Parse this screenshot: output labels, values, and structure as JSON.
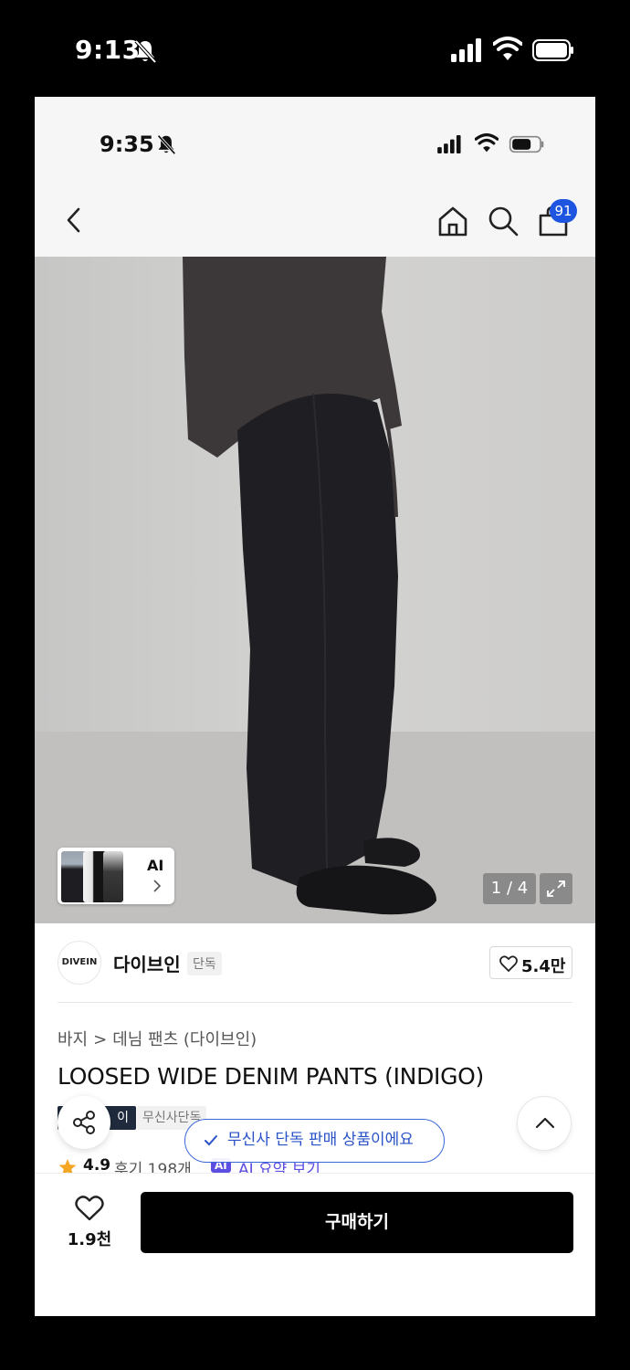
{
  "outer_status": {
    "time": "9:13"
  },
  "inner_status": {
    "time": "9:35"
  },
  "nav": {
    "icons": [
      "back-arrow-icon",
      "home-icon",
      "search-icon",
      "shopping-bag-icon"
    ],
    "cart_count": "91"
  },
  "gallery": {
    "thumb_label": "AI",
    "page_indicator": "1 / 4"
  },
  "brand": {
    "logo_text": "DIVEIN",
    "name": "다이브인",
    "tag": "단독",
    "likes": "5.4만"
  },
  "breadcrumb": {
    "category": "바지",
    "subcategory": "데님 팬츠 (다이브인)"
  },
  "product": {
    "title": "LOOSED WIDE DENIM PANTS (INDIGO)",
    "tag_dark": "이",
    "tag_light": "무신사단독"
  },
  "toast": {
    "message": "무신사 단독 판매 상품이에요"
  },
  "rating": {
    "score": "4.9",
    "reviews": "후기 198개",
    "ai_chip": "AI",
    "ai_summary": "AI 요약 보기"
  },
  "bottom_bar": {
    "wish_count": "1.9천",
    "buy_label": "구매하기"
  },
  "colors": {
    "accent_blue": "#1e55e0",
    "toast_blue": "#2952c8",
    "ai_purple": "#5b4ee0",
    "buy_button": "#000000",
    "star": "#f5a623"
  }
}
